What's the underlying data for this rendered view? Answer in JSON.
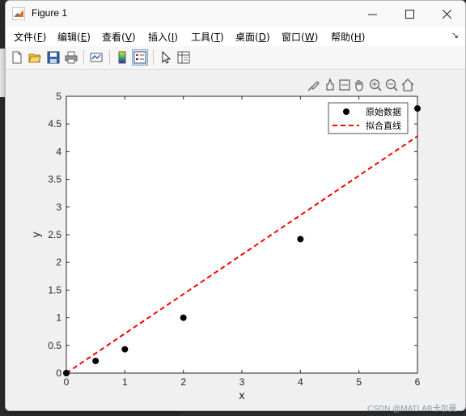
{
  "window": {
    "title": "Figure 1"
  },
  "menu": [
    {
      "text": "文件(",
      "key": "F",
      "close": ")"
    },
    {
      "text": "编辑(",
      "key": "E",
      "close": ")"
    },
    {
      "text": "查看(",
      "key": "V",
      "close": ")"
    },
    {
      "text": "插入(",
      "key": "I",
      "close": ")"
    },
    {
      "text": "工具(",
      "key": "T",
      "close": ")"
    },
    {
      "text": "桌面(",
      "key": "D",
      "close": ")"
    },
    {
      "text": "窗口(",
      "key": "W",
      "close": ")"
    },
    {
      "text": "帮助(",
      "key": "H",
      "close": ")"
    }
  ],
  "toolbar_icons": [
    "new-figure-icon",
    "open-file-icon",
    "save-icon",
    "print-icon",
    "link-plot-icon",
    "colorbar-icon",
    "legend-icon",
    "pointer-icon",
    "property-inspector-icon"
  ],
  "axes_toolbar_icons": [
    "brush-icon",
    "data-tip-icon",
    "restore-view-icon",
    "pan-icon",
    "zoom-in-icon",
    "zoom-out-icon",
    "home-icon"
  ],
  "watermark": "CSDN @MATLAB卡尔曼",
  "colors": {
    "data": "#000000",
    "fit": "#ff0000",
    "axes_bg": "#ffffff",
    "figure_bg": "#f0f0f0"
  },
  "chart_data": {
    "type": "scatter",
    "xlabel": "x",
    "ylabel": "y",
    "xlim": [
      0,
      6
    ],
    "ylim": [
      0,
      5
    ],
    "xticks": [
      0,
      1,
      2,
      3,
      4,
      5,
      6
    ],
    "yticks": [
      0,
      0.5,
      1,
      1.5,
      2,
      2.5,
      3,
      3.5,
      4,
      4.5,
      5
    ],
    "legend_position": "top-right",
    "grid": false,
    "series": [
      {
        "name": "原始数据",
        "kind": "points",
        "color": "#000000",
        "x": [
          0,
          0.5,
          1,
          2,
          4,
          6
        ],
        "y": [
          0,
          0.22,
          0.43,
          1.0,
          2.42,
          4.78
        ]
      },
      {
        "name": "拟合直线",
        "kind": "dashed-line",
        "color": "#ff0000",
        "x": [
          0,
          6
        ],
        "y": [
          0,
          4.28
        ]
      }
    ]
  }
}
